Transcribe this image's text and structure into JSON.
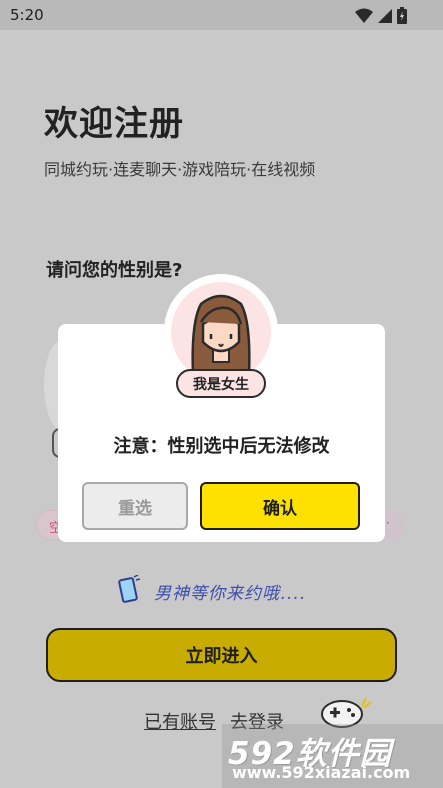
{
  "status_bar": {
    "time": "5:20"
  },
  "welcome": {
    "title": "欢迎注册",
    "subtitle": "同城约玩·连麦聊天·游戏陪玩·在线视频"
  },
  "gender_question": "请问您的性别是?",
  "background_chips": {
    "left_partial": "空",
    "right_partial": "·"
  },
  "invite_text": "男神等你来约哦....",
  "enter_button": "立即进入",
  "login": {
    "has_account": "已有账号",
    "go_login": "去登录"
  },
  "modal": {
    "gender_badge": "我是女生",
    "notice": "注意：性别选中后无法修改",
    "reselect_label": "重选",
    "confirm_label": "确认"
  },
  "watermark": {
    "brand": "592软件园",
    "url": "www.592xiazai.com"
  },
  "colors": {
    "overlay_bg": "#c9c9c9",
    "confirm_yellow": "#ffe100",
    "enter_button_dim": "#c8ac00",
    "avatar_pink": "#fde4e4",
    "invite_blue": "#3c4fb0"
  },
  "icons": [
    "wifi-icon",
    "signal-icon",
    "battery-icon",
    "phone-icon",
    "girl-avatar-icon",
    "gamepad-icon"
  ]
}
